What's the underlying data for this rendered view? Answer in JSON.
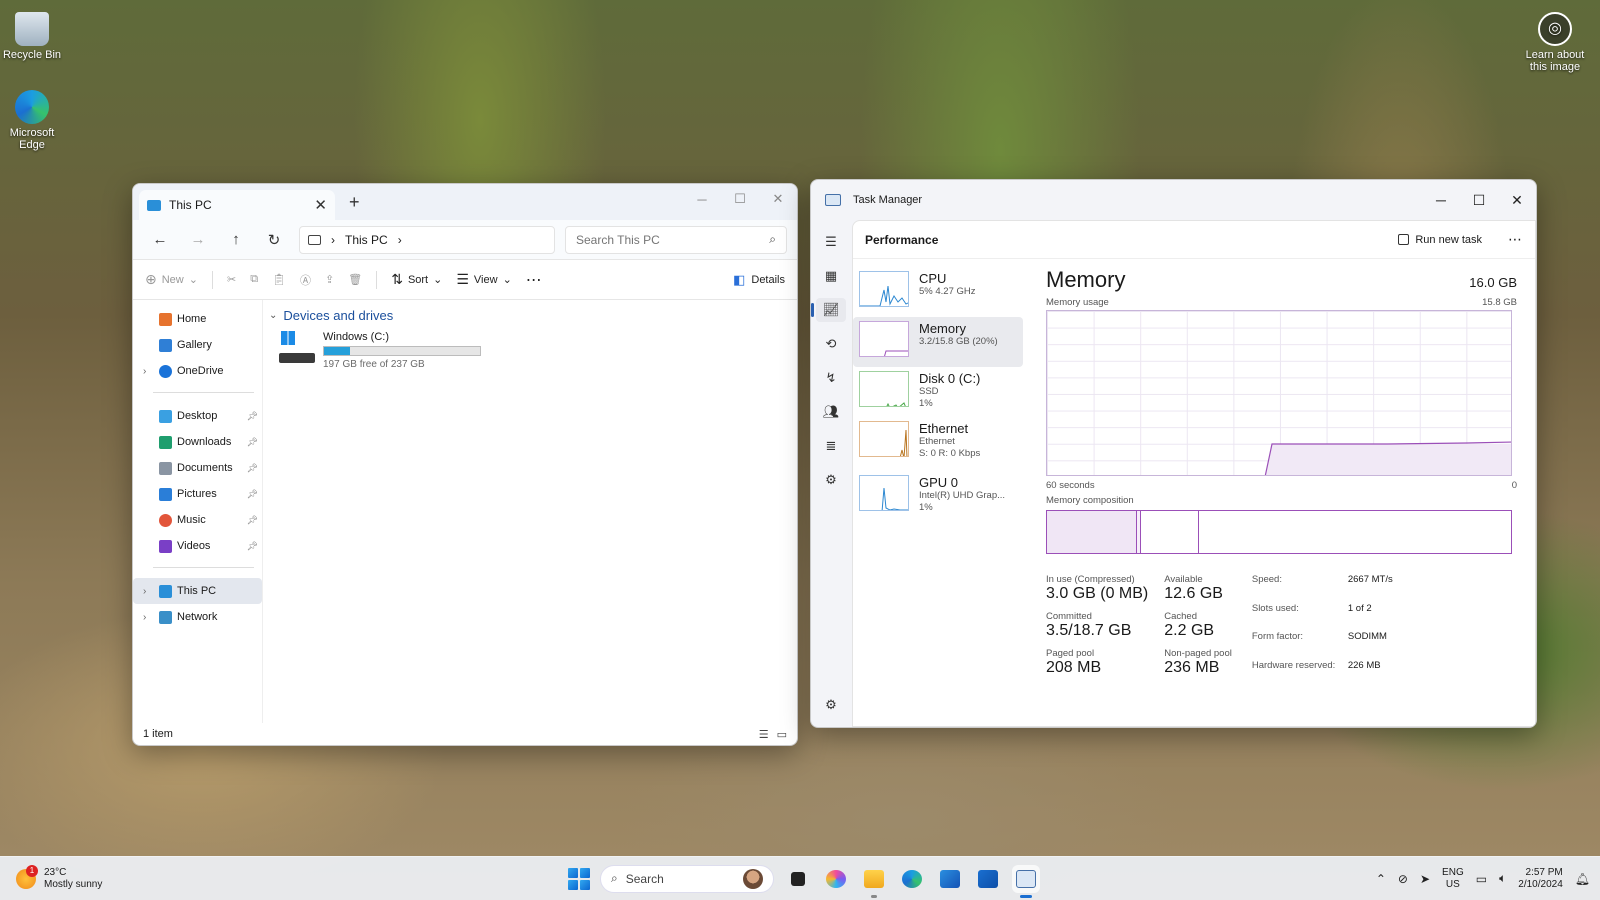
{
  "desktop": {
    "icons": [
      {
        "label": "Recycle Bin"
      },
      {
        "label": "Microsoft Edge"
      }
    ],
    "learn_about": "Learn about this image"
  },
  "explorer": {
    "tab_title": "This PC",
    "new_tab_glyph": "+",
    "address": {
      "root": "This PC"
    },
    "search_placeholder": "Search This PC",
    "commands": {
      "new": "New",
      "sort": "Sort",
      "view": "View",
      "details": "Details"
    },
    "sidebar": {
      "top": [
        "Home",
        "Gallery",
        "OneDrive"
      ],
      "pinned": [
        "Desktop",
        "Downloads",
        "Documents",
        "Pictures",
        "Music",
        "Videos"
      ],
      "bottom": [
        "This PC",
        "Network"
      ]
    },
    "group_header": "Devices and drives",
    "drive": {
      "name": "Windows (C:)",
      "free_text": "197 GB free of 237 GB",
      "used_fraction": 0.169
    },
    "status": "1 item"
  },
  "taskmgr": {
    "title": "Task Manager",
    "section": "Performance",
    "run_new_task": "Run new task",
    "perf_items": [
      {
        "name": "CPU",
        "sub1": "5%  4.27 GHz",
        "sub2": ""
      },
      {
        "name": "Memory",
        "sub1": "3.2/15.8 GB (20%)",
        "sub2": ""
      },
      {
        "name": "Disk 0 (C:)",
        "sub1": "SSD",
        "sub2": "1%"
      },
      {
        "name": "Ethernet",
        "sub1": "Ethernet",
        "sub2": "S: 0  R: 0 Kbps"
      },
      {
        "name": "GPU 0",
        "sub1": "Intel(R) UHD Grap...",
        "sub2": "1%"
      }
    ],
    "memory": {
      "heading": "Memory",
      "total": "16.0 GB",
      "usage_label": "Memory usage",
      "usage_max": "15.8 GB",
      "axis_left": "60 seconds",
      "axis_right": "0",
      "composition_label": "Memory composition",
      "in_use_label": "In use (Compressed)",
      "in_use_value": "3.0 GB (0 MB)",
      "available_label": "Available",
      "available_value": "12.6 GB",
      "committed_label": "Committed",
      "committed_value": "3.5/18.7 GB",
      "cached_label": "Cached",
      "cached_value": "2.2 GB",
      "paged_label": "Paged pool",
      "paged_value": "208 MB",
      "nonpaged_label": "Non-paged pool",
      "nonpaged_value": "236 MB",
      "speed_label": "Speed:",
      "speed_value": "2667 MT/s",
      "slots_label": "Slots used:",
      "slots_value": "1 of 2",
      "form_label": "Form factor:",
      "form_value": "SODIMM",
      "hwres_label": "Hardware reserved:",
      "hwres_value": "226 MB"
    }
  },
  "taskbar": {
    "weather_temp": "23°C",
    "weather_desc": "Mostly sunny",
    "weather_badge": "1",
    "search_label": "Search",
    "lang_top": "ENG",
    "lang_bottom": "US",
    "time": "2:57 PM",
    "date": "2/10/2024"
  }
}
